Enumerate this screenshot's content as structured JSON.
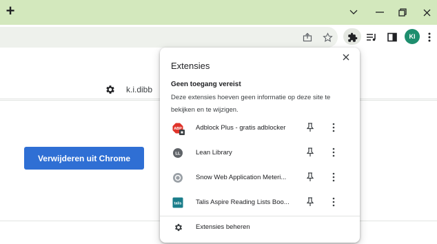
{
  "titlebar": {
    "new_tab": "+",
    "minimize": "—",
    "restore": "❐",
    "close": "✕",
    "chevron": "⌄"
  },
  "toolbar": {
    "avatar_initials": "KI"
  },
  "page": {
    "user_email": "k.i.dibb",
    "remove_button": "Verwijderen uit Chrome"
  },
  "popup": {
    "title": "Extensies",
    "section_title": "Geen toegang vereist",
    "section_desc": "Deze extensies hoeven geen informatie op deze site te bekijken en te wijzigen.",
    "extensions": [
      {
        "name": "Adblock Plus - gratis adblocker",
        "icon": "adblock-icon"
      },
      {
        "name": "Lean Library",
        "icon": "lean-library-icon"
      },
      {
        "name": "Snow Web Application Meteri...",
        "icon": "snow-icon"
      },
      {
        "name": "Talis Aspire Reading Lists Boo...",
        "icon": "talis-icon"
      }
    ],
    "manage": "Extensies beheren"
  },
  "colors": {
    "titlebar": "#d3e8bd",
    "accent": "#2f6fd4",
    "avatar": "#1e8e6e"
  }
}
